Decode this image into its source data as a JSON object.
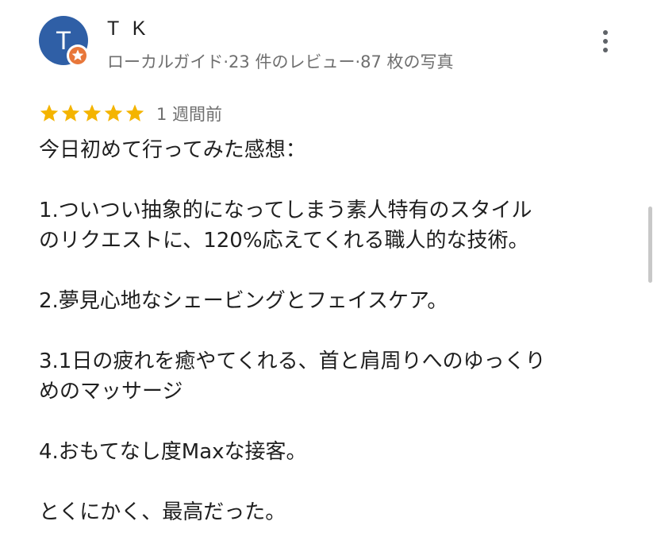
{
  "reviewer": {
    "avatar_initial": "T",
    "name": "T K",
    "meta": "ローカルガイド·23 件のレビュー·87 枚の写真",
    "badge_icon": "local-guide-star-icon",
    "avatar_color": "#2f5fa6",
    "badge_color": "#e8773a"
  },
  "menu": {
    "icon": "more-vert-icon"
  },
  "review": {
    "rating": 5,
    "max_rating": 5,
    "star_color": "#f4b400",
    "date": "1 週間前",
    "lines": [
      "今日初めて行ってみた感想：",
      "",
      "1.ついつい抽象的になってしまう素人特有のスタイル",
      "のリクエストに、120%応えてくれる職人的な技術。",
      "",
      "2.夢見心地なシェービングとフェイスケア。",
      "",
      "3.1日の疲れを癒やてくれる、首と肩周りへのゆっくり",
      "めのマッサージ",
      "",
      "4.おもてなし度Maxな接客。",
      "",
      "とくにかく、最高だった。"
    ]
  }
}
